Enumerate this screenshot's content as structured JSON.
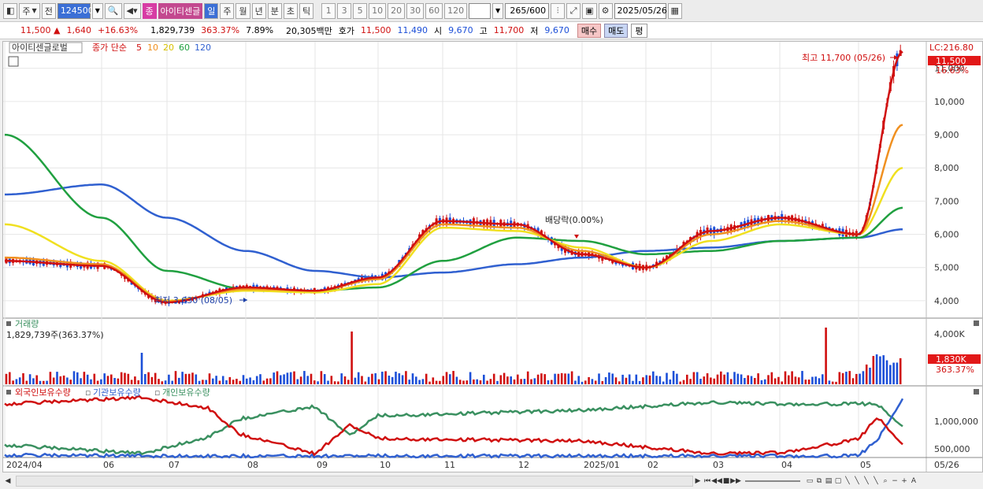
{
  "toolbar": {
    "market_label": "주",
    "prev_label": "전",
    "stock_code": "124500",
    "stock_badge": "종",
    "stock_name": "아이티센글",
    "periods": [
      "일",
      "주",
      "월",
      "년",
      "분",
      "초",
      "틱"
    ],
    "active_period": "일",
    "minutes": [
      "1",
      "3",
      "5",
      "10",
      "20",
      "30",
      "60",
      "120"
    ],
    "count_value": "265",
    "count_total": "/600",
    "date_value": "2025/05/26"
  },
  "info": {
    "price": "11,500",
    "change_arrow": "▲",
    "change": "1,640",
    "change_pct": "+16.63%",
    "volume": "1,829,739",
    "volume_pct": "363.37%",
    "turnover": "7.89%",
    "amount": "20,305백만",
    "quote_label": "호가",
    "ask": "11,500",
    "bid": "11,490",
    "open_label": "시",
    "open": "9,670",
    "high_label": "고",
    "high": "11,700",
    "low_label": "저",
    "low": "9,670",
    "buy_label": "매수",
    "sell_label": "매도",
    "flat_label": "평"
  },
  "price_panel": {
    "name_tag": "아이티센글로벌",
    "legend_prefix": "종가 단순",
    "ma_labels": [
      "5",
      "10",
      "20",
      "60",
      "120"
    ],
    "lc_label": "LC:216.80",
    "current_price_tag": "11,500",
    "current_pct_tag": "16.63%",
    "high_annotation": "최고 11,700 (05/26)",
    "low_annotation": "최저 3,630 (08/05)",
    "dividend_annotation": "배당락(0.00%)",
    "y_ticks": [
      "11,000",
      "10,000",
      "9,000",
      "8,000",
      "7,000",
      "6,000",
      "5,000",
      "4,000"
    ]
  },
  "volume_panel": {
    "title": "거래량",
    "value_text": "1,829,739주(363.37%)",
    "tag_value": "1,830K",
    "tag_pct": "363.37%",
    "y_ticks": [
      "4,000K"
    ]
  },
  "holding_panel": {
    "series_labels": [
      "외국인보유수량",
      "기관보유수량",
      "개인보유수량"
    ],
    "y_ticks": [
      "1,000,000",
      "500,000"
    ]
  },
  "x_axis": {
    "labels": [
      "2024/04",
      "06",
      "07",
      "08",
      "09",
      "10",
      "11",
      "12",
      "2025/01",
      "02",
      "03",
      "04",
      "05",
      "05/26"
    ]
  },
  "colors": {
    "up": "#d01010",
    "down": "#1c4fd8",
    "ma5": "#d01010",
    "ma10": "#f09020",
    "ma20": "#f0e020",
    "ma60": "#20a040",
    "ma120": "#3060d0",
    "foreign": "#d01010",
    "institution": "#3060d0",
    "individual": "#3a9060"
  },
  "chart_data": {
    "type": "line",
    "title": "",
    "x_dates": [
      "2024/04",
      "06",
      "07",
      "08",
      "09",
      "10",
      "11",
      "12",
      "2025/01",
      "02",
      "03",
      "04",
      "05",
      "05/26"
    ],
    "series": [
      {
        "name": "5",
        "values": [
          5200,
          5050,
          3950,
          4400,
          4300,
          4700,
          6400,
          6300,
          5400,
          5000,
          6100,
          6500,
          6000,
          11500
        ]
      },
      {
        "name": "10",
        "values": [
          5300,
          5100,
          3980,
          4350,
          4300,
          4650,
          6300,
          6200,
          5500,
          5000,
          6000,
          6400,
          6000,
          9300
        ]
      },
      {
        "name": "20",
        "values": [
          6300,
          5200,
          4000,
          4300,
          4250,
          4500,
          6200,
          6100,
          5600,
          5000,
          5800,
          6300,
          6000,
          8000
        ]
      },
      {
        "name": "60",
        "values": [
          9000,
          6500,
          4900,
          4350,
          4300,
          4400,
          5200,
          5900,
          5800,
          5400,
          5500,
          5800,
          5900,
          6800
        ]
      },
      {
        "name": "120",
        "values": [
          7200,
          7500,
          6500,
          5500,
          4900,
          4700,
          4850,
          5100,
          5300,
          5500,
          5600,
          5800,
          5900,
          6150
        ]
      }
    ],
    "ylabel": "",
    "ylim": [
      3500,
      11800
    ]
  }
}
